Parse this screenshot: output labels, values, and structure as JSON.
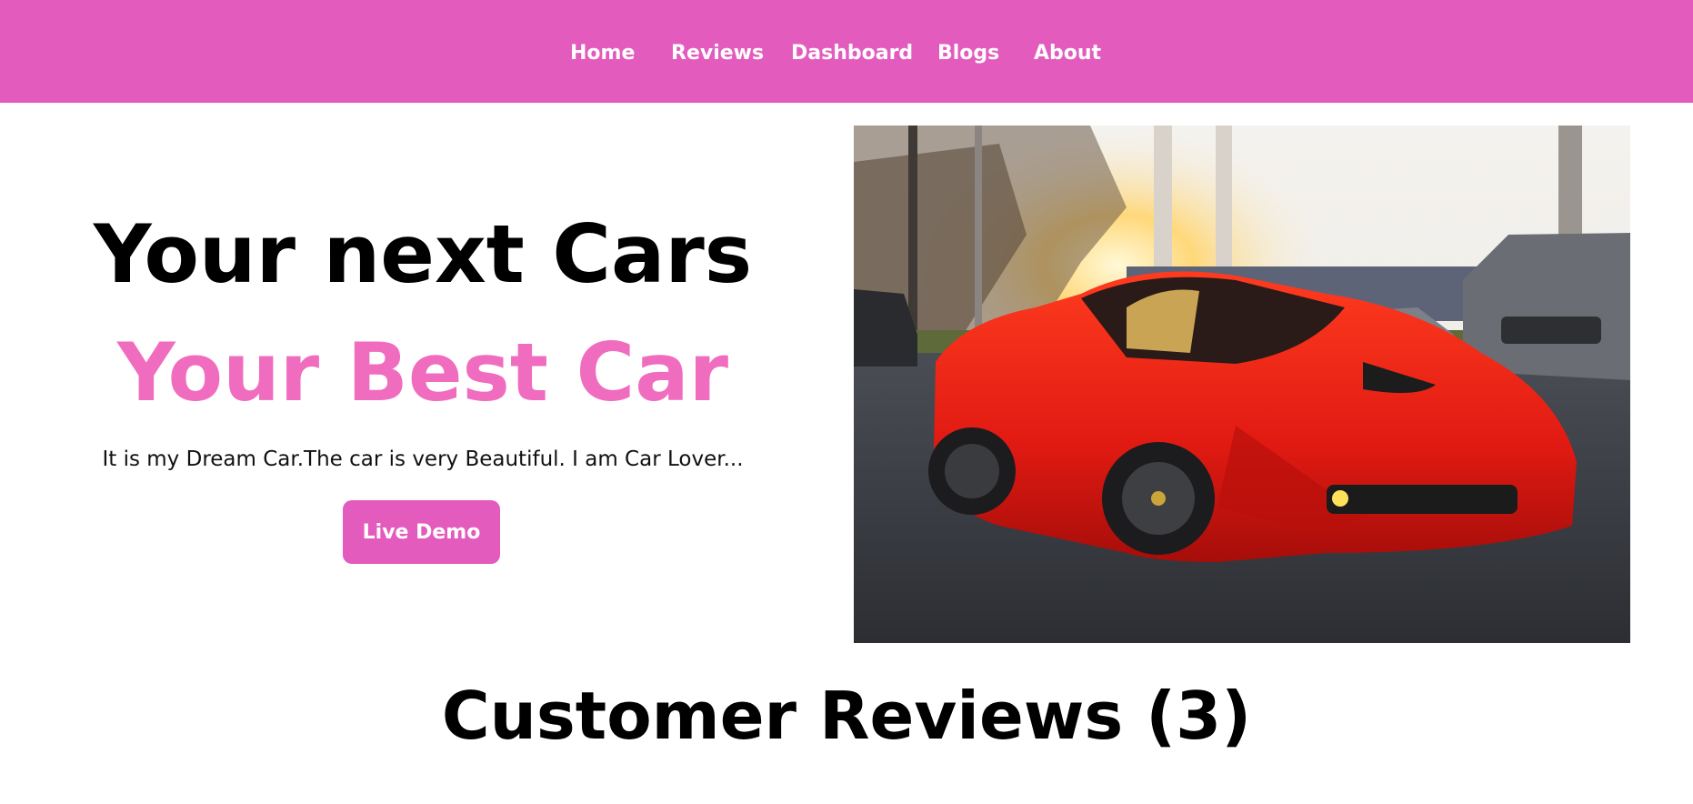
{
  "nav": {
    "items": [
      {
        "label": "Home"
      },
      {
        "label": "Reviews"
      },
      {
        "label": "Dashboard"
      },
      {
        "label": "Blogs"
      },
      {
        "label": "About"
      }
    ]
  },
  "hero": {
    "headline": "Your next Cars",
    "subheadline": "Your Best Car",
    "tagline": "It is my Dream Car.The car is very Beautiful. I am Car Lover...",
    "cta_label": "Live Demo",
    "image_subject": "red sports car"
  },
  "reviews": {
    "title": "Customer Reviews (3)"
  },
  "colors": {
    "nav_bg": "#e35bbd",
    "accent": "#f06cbf",
    "button_bg": "#e35bbd",
    "text": "#000000"
  }
}
